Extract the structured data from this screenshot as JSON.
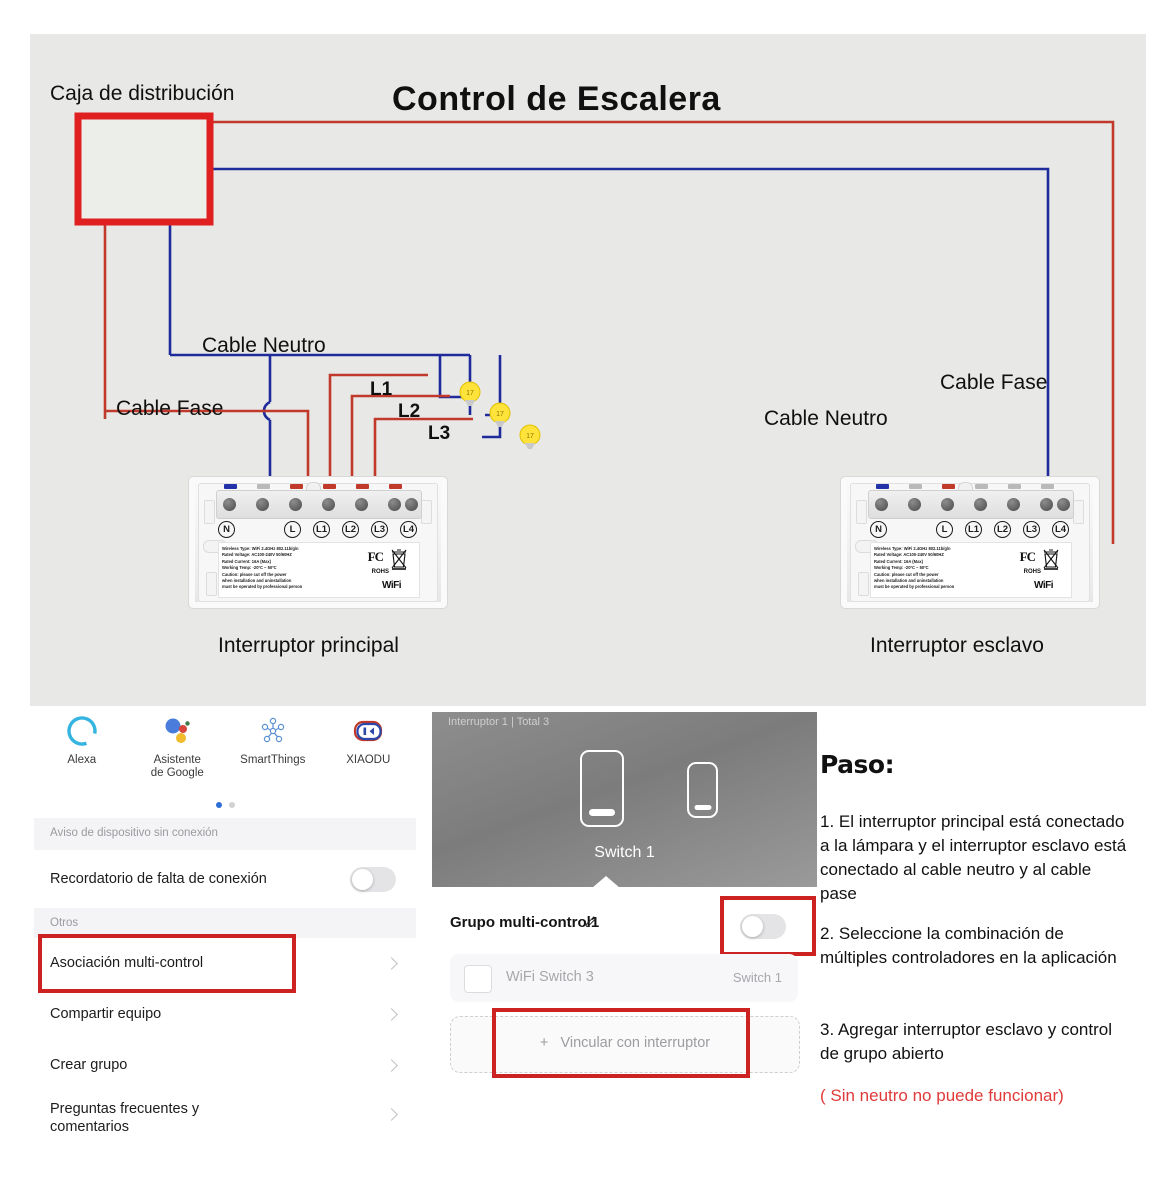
{
  "diagram": {
    "title": "Control de Escalera",
    "labels": {
      "dist_box": "Caja de distribución",
      "neutral_left": "Cable Neutro",
      "phase_left": "Cable Fase",
      "neutral_right": "Cable Neutro",
      "phase_right": "Cable Fase",
      "main_switch": "Interruptor principal",
      "slave_switch": "Interruptor esclavo"
    },
    "lamps": [
      "L1",
      "L2",
      "L3"
    ],
    "wire_colors": {
      "phase": "#c0392b",
      "neutral": "#1f2a9b"
    },
    "switch": {
      "terminals": [
        "N",
        "L",
        "L1",
        "L2",
        "L3",
        "L4"
      ],
      "spec_lines": [
        "Wireless Type: WiFi 2.4GHz 802.11b/g/n",
        "Rated Voltage: AC100-240V 50/60HZ",
        "Rated Current:  16A (Max)",
        "Working Temp: -20ºC ~ 50ºC",
        "Caution: please cut off the power",
        "when installation and uninstallation",
        "must be operated by professional person"
      ],
      "marks": {
        "fc": "FC",
        "rohs": "ROHS",
        "wifi": "WiFi"
      }
    }
  },
  "app_left": {
    "integrations": [
      {
        "label": "Alexa",
        "icon": "alexa-icon"
      },
      {
        "label": "Asistente\nde Google",
        "icon": "google-assistant-icon"
      },
      {
        "label": "SmartThings",
        "icon": "smartthings-icon"
      },
      {
        "label": "XIAODU",
        "icon": "xiaodu-icon"
      }
    ],
    "section_offline": "Aviso de dispositivo sin conexión",
    "offline_reminder": "Recordatorio de falta de conexión",
    "offline_toggle_state": "off",
    "section_others": "Otros",
    "menu": [
      "Asociación multi-control",
      "Compartir equipo",
      "Crear grupo",
      "Preguntas frecuentes y comentarios"
    ],
    "highlight_color": "#cc2222"
  },
  "app_mid": {
    "hero_title": "Interruptor 1 | Total 3",
    "hero_label": "Switch 1",
    "group_title": "Grupo multi-control1",
    "group_toggle_state": "off",
    "linked_device": {
      "name": "WiFi Switch 3",
      "value": "Switch 1"
    },
    "link_button": "Vincular con interruptor",
    "link_button_plus": "+"
  },
  "steps": {
    "heading": "Paso:",
    "items": [
      "1. El interruptor principal está conectado a la lámpara y el interruptor esclavo está conectado al cable neutro y al cable pase",
      "2. Seleccione la combinación de múltiples controladores en la aplicación",
      "3. Agregar interruptor esclavo y control de grupo abierto"
    ],
    "note": "( Sin neutro no puede funcionar)",
    "note_color": "#e03a3a"
  }
}
